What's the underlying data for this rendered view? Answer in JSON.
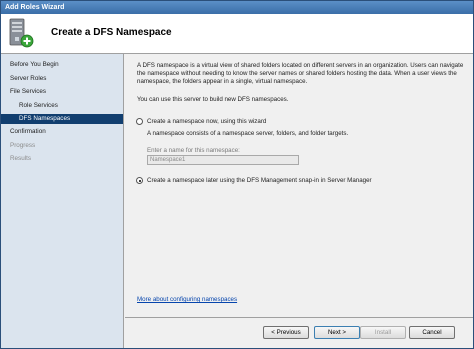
{
  "window": {
    "title": "Add Roles Wizard"
  },
  "header": {
    "title": "Create a DFS Namespace",
    "icon": "server-add-icon"
  },
  "sidebar": {
    "items": [
      {
        "label": "Before You Begin",
        "state": "normal"
      },
      {
        "label": "Server Roles",
        "state": "normal"
      },
      {
        "label": "File Services",
        "state": "normal"
      },
      {
        "label": "Role Services",
        "state": "normal"
      },
      {
        "label": "DFS Namespaces",
        "state": "active"
      },
      {
        "label": "Confirmation",
        "state": "normal"
      },
      {
        "label": "Progress",
        "state": "disabled"
      },
      {
        "label": "Results",
        "state": "disabled"
      }
    ]
  },
  "content": {
    "intro": "A DFS namespace is a virtual view of shared folders located on different servers in an organization. Users can navigate the namespace without needing to know the server names or shared folders hosting the data. When a user views the namespace, the folders appear in a single, virtual namespace.",
    "can_use": "You can use this server to build new DFS namespaces.",
    "option_now": {
      "label": "Create a namespace now, using this wizard",
      "description": "A namespace consists of a namespace server, folders, and folder targets.",
      "name_label": "Enter a name for this namespace:",
      "name_value": "Namespace1",
      "selected": false
    },
    "option_later": {
      "label": "Create a namespace later using the DFS Management snap-in in Server Manager",
      "selected": true
    },
    "more_link": "More about configuring namespaces"
  },
  "footer": {
    "previous": "< Previous",
    "next": "Next >",
    "install": "Install",
    "cancel": "Cancel"
  },
  "colors": {
    "active_nav": "#113e6f",
    "sidebar_bg": "#dbe4ee",
    "link": "#0645ad"
  }
}
